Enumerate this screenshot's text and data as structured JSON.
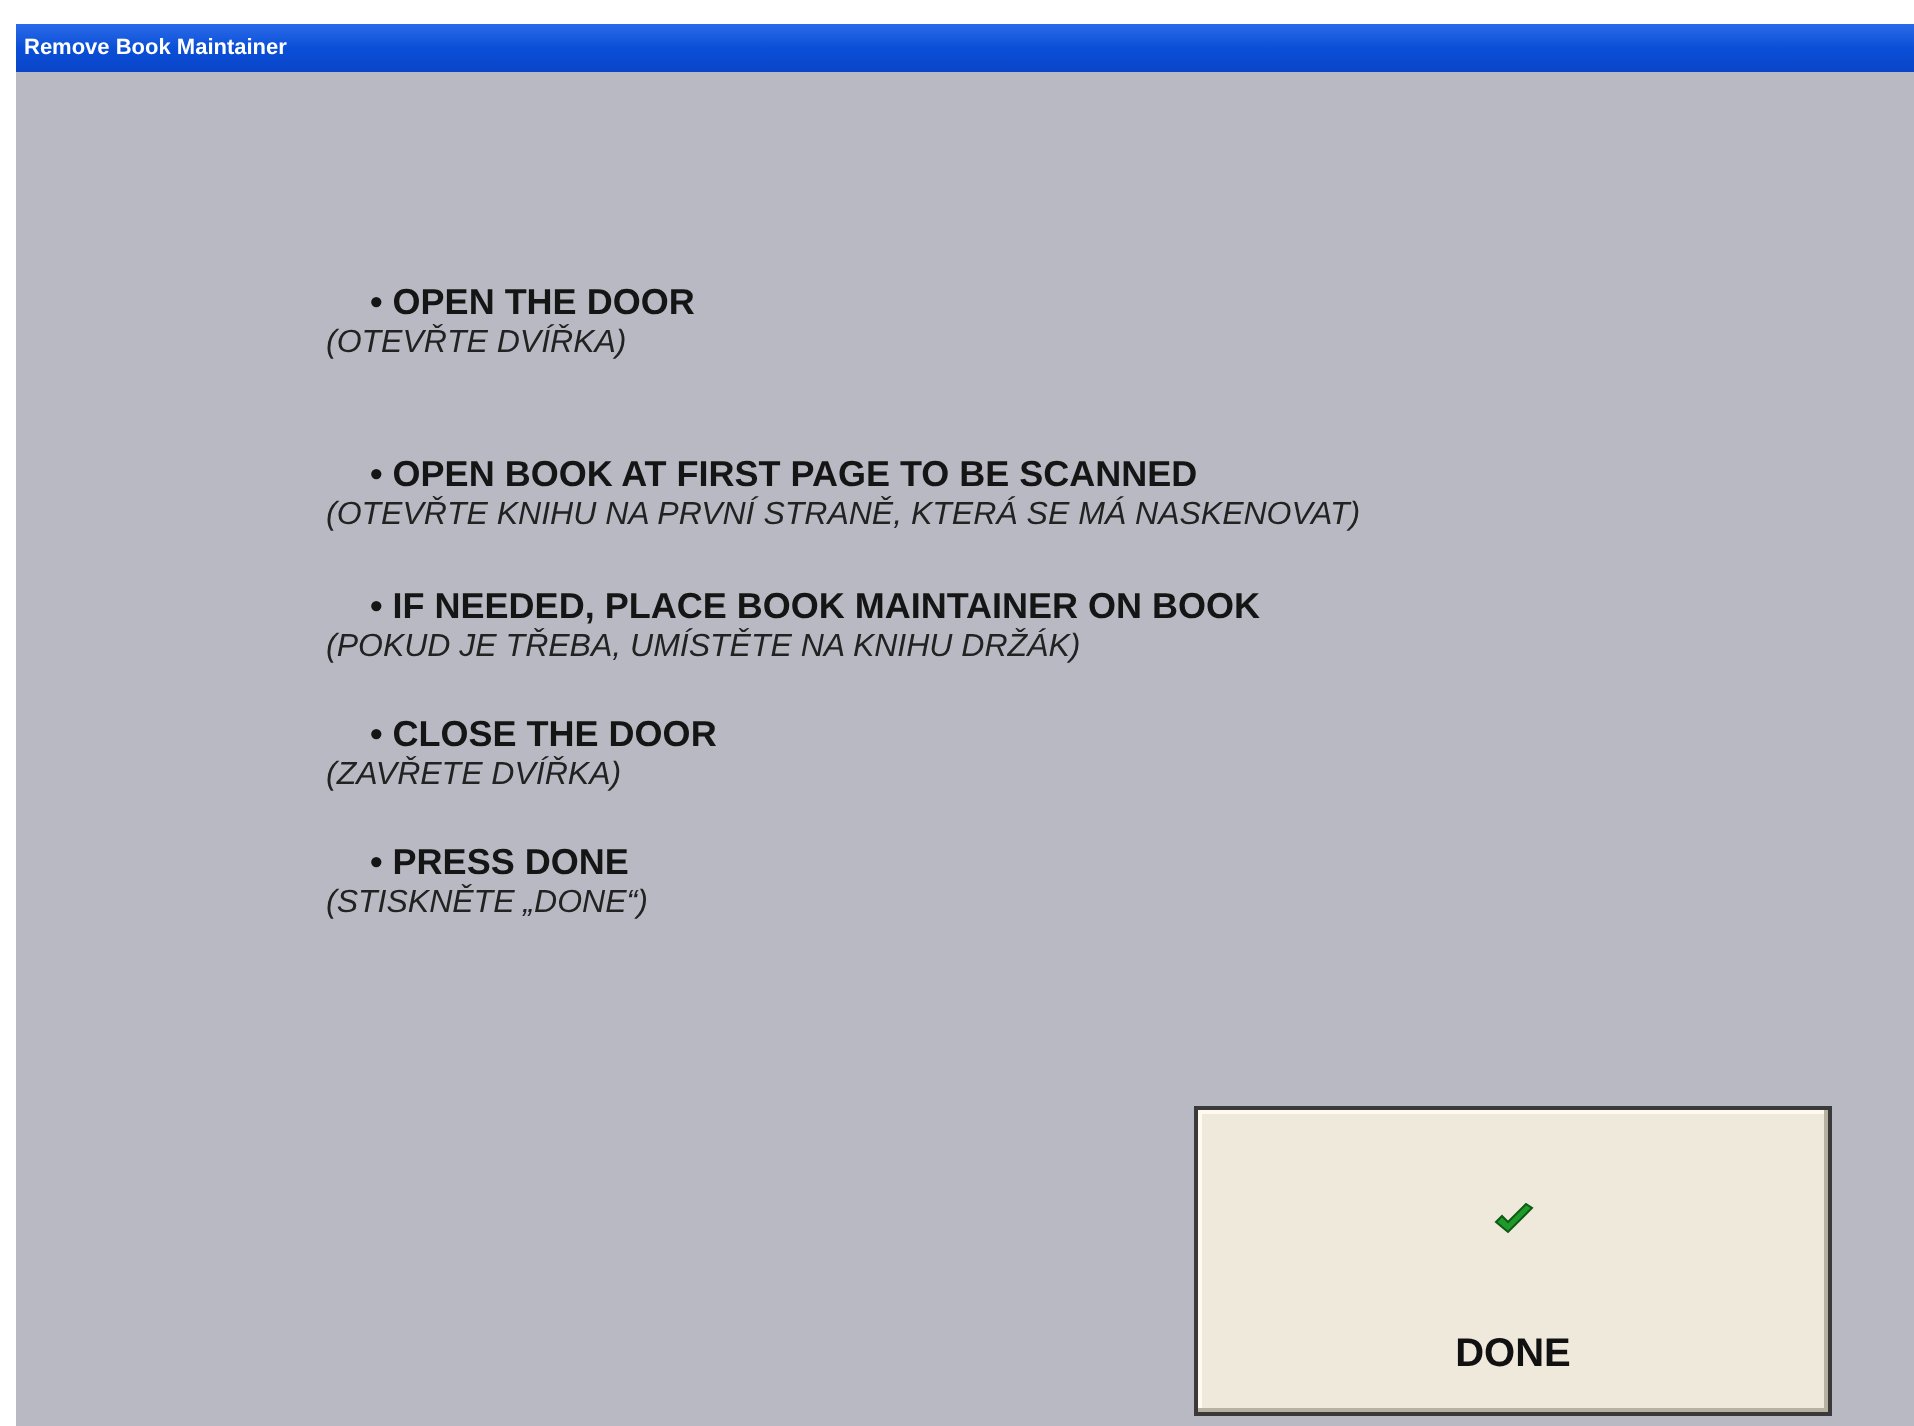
{
  "window": {
    "title": "Remove Book Maintainer"
  },
  "steps": [
    {
      "instruction": "• OPEN THE DOOR",
      "translation": "(OTEVŘTE DVÍŘKA)"
    },
    {
      "instruction": "• OPEN BOOK AT FIRST PAGE TO BE SCANNED",
      "translation": "(OTEVŘTE KNIHU NA PRVNÍ STRANĚ, KTERÁ SE MÁ NASKENOVAT)"
    },
    {
      "instruction": "• IF NEEDED, PLACE BOOK MAINTAINER ON BOOK",
      "translation": "(POKUD JE TŘEBA, UMÍSTĚTE NA KNIHU DRŽÁK)"
    },
    {
      "instruction": "• CLOSE THE DOOR",
      "translation": "(ZAVŘETE DVÍŘKA)"
    },
    {
      "instruction": "• PRESS DONE",
      "translation": "(STISKNĚTE „DONE“)"
    }
  ],
  "done_button": {
    "label": "DONE"
  }
}
